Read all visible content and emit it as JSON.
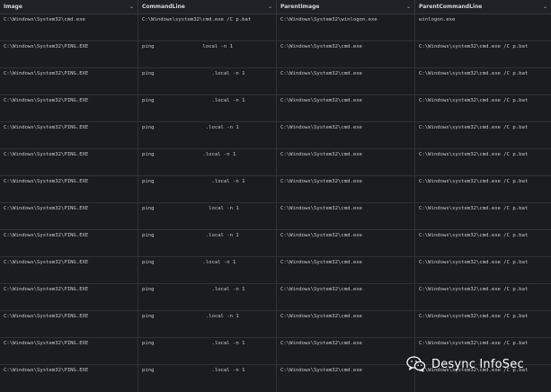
{
  "columns": [
    {
      "label": "Image"
    },
    {
      "label": "CommandLine"
    },
    {
      "label": "ParentImage"
    },
    {
      "label": "ParentCommandLine"
    }
  ],
  "rows": [
    {
      "image": "C:\\Windows\\System32\\cmd.exe",
      "command_line": "C:\\Windows\\system32\\cmd.exe /C p.bat",
      "parent_image": "C:\\Windows\\System32\\winlogon.exe",
      "parent_command_line": "winlogon.exe"
    },
    {
      "image": "C:\\Windows\\System32\\PING.EXE",
      "command_line": "ping                local -n 1",
      "parent_image": "C:\\Windows\\System32\\cmd.exe",
      "parent_command_line": "C:\\Windows\\system32\\cmd.exe /C p.bat"
    },
    {
      "image": "C:\\Windows\\System32\\PING.EXE",
      "command_line": "ping                   .local -n 1",
      "parent_image": "C:\\Windows\\System32\\cmd.exe",
      "parent_command_line": "C:\\Windows\\system32\\cmd.exe /C p.bat"
    },
    {
      "image": "C:\\Windows\\System32\\PING.EXE",
      "command_line": "ping                   .local -n 1",
      "parent_image": "C:\\Windows\\System32\\cmd.exe",
      "parent_command_line": "C:\\Windows\\system32\\cmd.exe /C p.bat"
    },
    {
      "image": "C:\\Windows\\System32\\PING.EXE",
      "command_line": "ping                 .local -n 1",
      "parent_image": "C:\\Windows\\System32\\cmd.exe",
      "parent_command_line": "C:\\Windows\\system32\\cmd.exe /C p.bat"
    },
    {
      "image": "C:\\Windows\\System32\\PING.EXE",
      "command_line": "ping                .local -n 1",
      "parent_image": "C:\\Windows\\System32\\cmd.exe",
      "parent_command_line": "C:\\Windows\\system32\\cmd.exe /C p.bat"
    },
    {
      "image": "C:\\Windows\\System32\\PING.EXE",
      "command_line": "ping                   .local -n 1",
      "parent_image": "C:\\Windows\\System32\\cmd.exe",
      "parent_command_line": "C:\\Windows\\system32\\cmd.exe /C p.bat"
    },
    {
      "image": "C:\\Windows\\System32\\PING.EXE",
      "command_line": "ping                  local -n 1",
      "parent_image": "C:\\Windows\\System32\\cmd.exe",
      "parent_command_line": "C:\\Windows\\system32\\cmd.exe /C p.bat"
    },
    {
      "image": "C:\\Windows\\System32\\PING.EXE",
      "command_line": "ping                 .local -n 1",
      "parent_image": "C:\\Windows\\System32\\cmd.exe",
      "parent_command_line": "C:\\Windows\\system32\\cmd.exe /C p.bat"
    },
    {
      "image": "C:\\Windows\\System32\\PING.EXE",
      "command_line": "ping                .local -n 1",
      "parent_image": "C:\\Windows\\System32\\cmd.exe",
      "parent_command_line": "C:\\Windows\\system32\\cmd.exe /C p.bat"
    },
    {
      "image": "C:\\Windows\\System32\\PING.EXE",
      "command_line": "ping                   .local -n 1",
      "parent_image": "C:\\Windows\\System32\\cmd.exe",
      "parent_command_line": "C:\\Windows\\system32\\cmd.exe /C p.bat"
    },
    {
      "image": "C:\\Windows\\System32\\PING.EXE",
      "command_line": "ping                 .local -n 1",
      "parent_image": "C:\\Windows\\System32\\cmd.exe",
      "parent_command_line": "C:\\Windows\\system32\\cmd.exe /C p.bat"
    },
    {
      "image": "C:\\Windows\\System32\\PING.EXE",
      "command_line": "ping                   .local -n 1",
      "parent_image": "C:\\Windows\\System32\\cmd.exe",
      "parent_command_line": "C:\\Windows\\system32\\cmd.exe /C p.bat"
    },
    {
      "image": "C:\\Windows\\System32\\PING.EXE",
      "command_line": "ping                   .local -n 1",
      "parent_image": "C:\\Windows\\System32\\cmd.exe",
      "parent_command_line": "C:\\Windows\\system32\\cmd.exe /C p.bat"
    }
  ],
  "watermark": {
    "text": "Desync InfoSec",
    "icon": "wechat-icon"
  },
  "colors": {
    "background": "#1b1c20",
    "header_background": "#202126",
    "text": "#c7c9cf",
    "divider": "#303237"
  }
}
